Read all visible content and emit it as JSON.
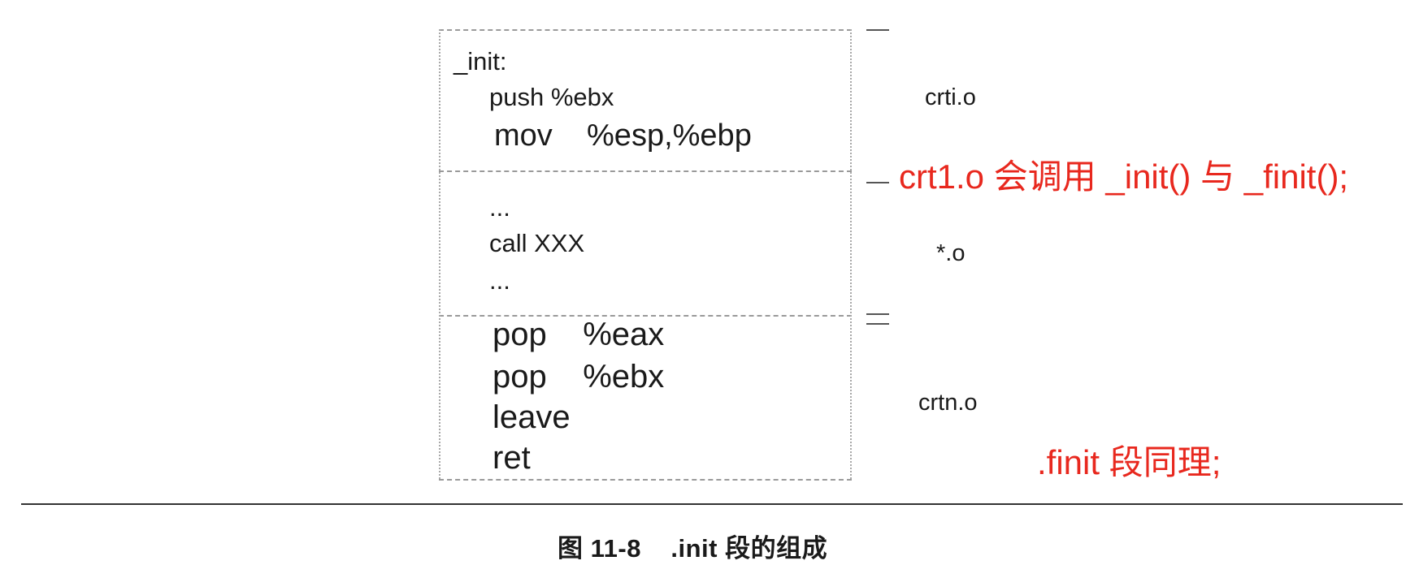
{
  "sections": [
    {
      "lines": [
        "_init:",
        "push %ebx",
        "mov    %esp,%ebp"
      ],
      "label": "crti.o"
    },
    {
      "lines": [
        "...",
        "call XXX",
        "..."
      ],
      "label": "*.o"
    },
    {
      "lines": [
        "pop    %eax",
        "pop    %ebx",
        "leave",
        "ret"
      ],
      "label": "crtn.o"
    }
  ],
  "annotations": {
    "crt1": "crt1.o 会调用 _init() 与 _finit();",
    "finit": ".finit 段同理;"
  },
  "caption": "图 11-8    .init 段的组成",
  "colors": {
    "annotation": "#e8281e",
    "text": "#1a1a1a",
    "frame": "#9a9a9a"
  }
}
